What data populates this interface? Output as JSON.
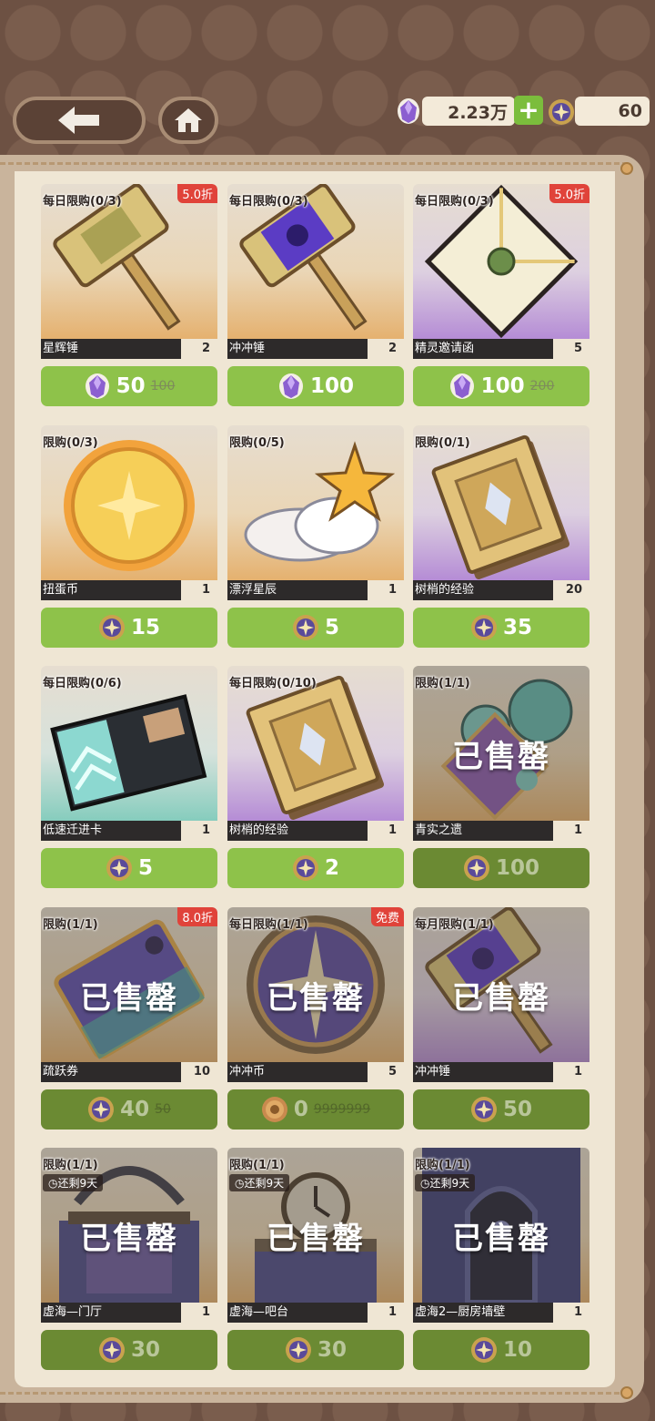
{
  "currency": {
    "gems_value": "2.23万",
    "coins_value": "60",
    "plus_label": "+"
  },
  "colors": {
    "price_green": "#8ec24a",
    "price_green_sold": "#6b8a33",
    "discount_red": "#e0433a",
    "panel": "#efe6d4",
    "frame": "#6d5143"
  },
  "sold_label": "已售罄",
  "items": [
    {
      "limit": "每日限购(0/3)",
      "discount": "5.0折",
      "name": "星辉锤",
      "qty": "2",
      "price": "50",
      "orig": "100",
      "currency_icon": "gem-icon",
      "art": "hammer-gold",
      "sold": false
    },
    {
      "limit": "每日限购(0/3)",
      "discount": "",
      "name": "冲冲锤",
      "qty": "2",
      "price": "100",
      "orig": "",
      "currency_icon": "gem-icon",
      "art": "hammer-purple",
      "sold": false
    },
    {
      "limit": "每日限购(0/3)",
      "discount": "5.0折",
      "name": "精灵邀请函",
      "qty": "5",
      "price": "100",
      "orig": "200",
      "currency_icon": "gem-icon",
      "art": "envelope",
      "sold": false
    },
    {
      "limit": "限购(0/3)",
      "discount": "",
      "name": "扭蛋币",
      "qty": "1",
      "price": "15",
      "orig": "",
      "currency_icon": "coin-icon",
      "art": "gold-coin",
      "sold": false
    },
    {
      "limit": "限购(0/5)",
      "discount": "",
      "name": "漂浮星辰",
      "qty": "1",
      "price": "5",
      "orig": "",
      "currency_icon": "coin-icon",
      "art": "star-cloud",
      "sold": false
    },
    {
      "limit": "限购(0/1)",
      "discount": "",
      "name": "树梢的经验",
      "qty": "20",
      "price": "35",
      "orig": "",
      "currency_icon": "coin-icon",
      "art": "book",
      "sold": false
    },
    {
      "limit": "每日限购(0/6)",
      "discount": "",
      "name": "低速迁进卡",
      "qty": "1",
      "price": "5",
      "orig": "",
      "currency_icon": "coin-icon",
      "art": "card",
      "sold": false
    },
    {
      "limit": "每日限购(0/10)",
      "discount": "",
      "name": "树梢的经验",
      "qty": "1",
      "price": "2",
      "orig": "",
      "currency_icon": "coin-icon",
      "art": "book",
      "sold": false
    },
    {
      "limit": "限购(1/1)",
      "discount": "",
      "name": "青实之遗",
      "qty": "1",
      "price": "100",
      "orig": "",
      "currency_icon": "coin-icon",
      "art": "orbs",
      "sold": true
    },
    {
      "limit": "限购(1/1)",
      "discount": "8.0折",
      "name": "疏跃券",
      "qty": "10",
      "price": "40",
      "orig": "50",
      "currency_icon": "coin-icon",
      "art": "ticket",
      "sold": true
    },
    {
      "limit": "每日限购(1/1)",
      "discount": "免费",
      "name": "冲冲币",
      "qty": "5",
      "price": "0",
      "orig": "9999999",
      "currency_icon": "bronze-coin-icon",
      "art": "badge",
      "sold": true
    },
    {
      "limit": "每月限购(1/1)",
      "discount": "",
      "name": "冲冲锤",
      "qty": "1",
      "price": "50",
      "orig": "",
      "currency_icon": "coin-icon",
      "art": "hammer-purple",
      "sold": true
    },
    {
      "limit": "限购(1/1)",
      "timer": "还剩9天",
      "discount": "",
      "name": "虚海—门厅",
      "qty": "1",
      "price": "30",
      "orig": "",
      "currency_icon": "coin-icon",
      "art": "room-hall",
      "sold": true
    },
    {
      "limit": "限购(1/1)",
      "timer": "还剩9天",
      "discount": "",
      "name": "虚海—吧台",
      "qty": "1",
      "price": "30",
      "orig": "",
      "currency_icon": "coin-icon",
      "art": "room-bar",
      "sold": true
    },
    {
      "limit": "限购(1/1)",
      "timer": "还剩9天",
      "discount": "",
      "name": "虚海2—厨房墙壁",
      "qty": "1",
      "price": "10",
      "orig": "",
      "currency_icon": "coin-icon",
      "art": "room-wall",
      "sold": true
    }
  ]
}
